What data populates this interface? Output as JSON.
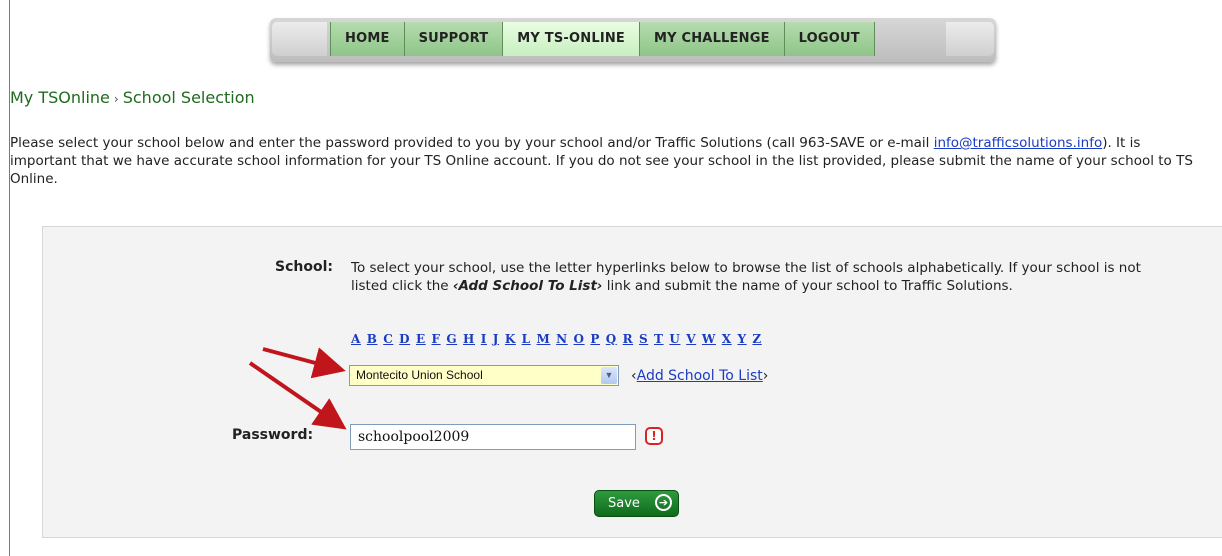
{
  "nav": {
    "items": [
      {
        "label": "HOME"
      },
      {
        "label": "SUPPORT"
      },
      {
        "label": "MY TS-ONLINE"
      },
      {
        "label": "MY CHALLENGE"
      },
      {
        "label": "LOGOUT"
      }
    ],
    "active_index": 2
  },
  "breadcrumb": {
    "root": "My TSOnline",
    "separator": "›",
    "current": "School Selection"
  },
  "intro": {
    "text_before": "Please select your school below and enter the password provided to you by your school and/or Traffic Solutions (call 963-SAVE or e-mail ",
    "email": "info@trafficsolutions.info",
    "text_after": "). It is important that we have accurate school information for your TS Online account. If you do not see your school in the list provided, please submit the name of your school to TS Online."
  },
  "form": {
    "school_label": "School:",
    "school_help_before": "To select your school, use the letter hyperlinks below to browse the list of schools alphabetically. If your school is not listed click the ",
    "school_help_link": "‹Add School To List›",
    "school_help_after": " link and submit the name of your school to Traffic Solutions.",
    "letters": [
      "A",
      "B",
      "C",
      "D",
      "E",
      "F",
      "G",
      "H",
      "I",
      "J",
      "K",
      "L",
      "M",
      "N",
      "O",
      "P",
      "Q",
      "R",
      "S",
      "T",
      "U",
      "V",
      "W",
      "X",
      "Y",
      "Z"
    ],
    "school_select_value": "Montecito Union School",
    "add_school_open": "‹",
    "add_school_label": "Add School To List",
    "add_school_close": "›",
    "password_label": "Password:",
    "password_value": "schoolpool2009",
    "save_label": "Save"
  },
  "colors": {
    "nav_green": "#a9d6a2",
    "nav_active": "#dff8d8",
    "breadcrumb_green": "#1f6b1f",
    "link_blue": "#1a3cc4",
    "save_green": "#1e7f2c",
    "annotation_red": "#c0151b"
  },
  "icons": {
    "select_arrow": "chevron-down-icon",
    "warning": "exclamation-icon",
    "save_go": "arrow-circle-right-icon"
  }
}
